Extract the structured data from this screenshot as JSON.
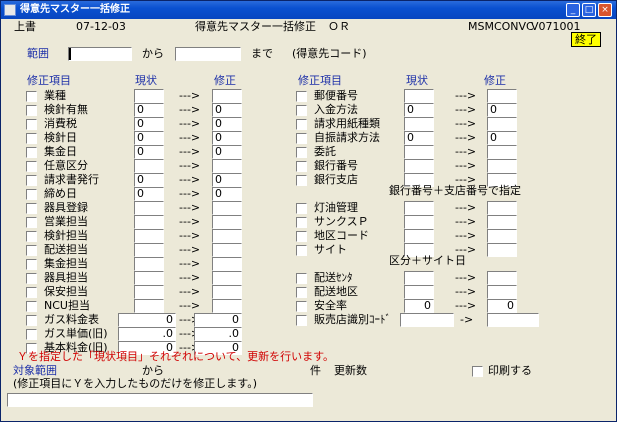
{
  "window": {
    "title": "得意先マスター一括修正"
  },
  "header": {
    "mode": "上書",
    "date": "07-12-03",
    "screen_title": "得意先マスター一括修正",
    "or_label": "ＯＲ",
    "program_id": "MSMCONVC",
    "version": "V071001",
    "exit_label": "終了"
  },
  "range": {
    "label": "範囲",
    "from_label": "から",
    "to_label": "まで",
    "note": "(得意先コード)"
  },
  "columns": {
    "item": "修正項目",
    "current": "現状",
    "modify": "修正"
  },
  "arrow": "--->",
  "arrow_short": "->",
  "left_items": [
    {
      "label": "業種",
      "current": "",
      "modify": ""
    },
    {
      "label": "検針有無",
      "current": "0",
      "modify": "0"
    },
    {
      "label": "消費税",
      "current": "0",
      "modify": "0"
    },
    {
      "label": "検針日",
      "current": "0",
      "modify": "0"
    },
    {
      "label": "集金日",
      "current": "0",
      "modify": "0"
    },
    {
      "label": "任意区分",
      "current": "",
      "modify": ""
    },
    {
      "label": "請求書発行",
      "current": "0",
      "modify": "0"
    },
    {
      "label": "締め日",
      "current": "0",
      "modify": "0"
    },
    {
      "label": "器具登録",
      "current": "",
      "modify": ""
    },
    {
      "label": "営業担当",
      "current": "",
      "modify": ""
    },
    {
      "label": "検針担当",
      "current": "",
      "modify": ""
    },
    {
      "label": "配送担当",
      "current": "",
      "modify": ""
    },
    {
      "label": "集金担当",
      "current": "",
      "modify": ""
    },
    {
      "label": "器具担当",
      "current": "",
      "modify": ""
    },
    {
      "label": "保安担当",
      "current": "",
      "modify": ""
    },
    {
      "label": "NCU担当",
      "current": "",
      "modify": ""
    },
    {
      "label": "ガス料金表",
      "current": "0",
      "modify": "0"
    },
    {
      "label": "ガス単価(旧)",
      "current": ".0",
      "modify": ".0"
    },
    {
      "label": "基本料金(旧)",
      "current": "0",
      "modify": "0"
    }
  ],
  "right_items": [
    {
      "label": "郵便番号",
      "current": "",
      "modify": ""
    },
    {
      "label": "入金方法",
      "current": "0",
      "modify": "0"
    },
    {
      "label": "請求用紙種類",
      "current": "",
      "modify": ""
    },
    {
      "label": "自振請求方法",
      "current": "0",
      "modify": "0"
    },
    {
      "label": "委託",
      "current": "",
      "modify": ""
    },
    {
      "label": "銀行番号",
      "current": "",
      "modify": ""
    },
    {
      "label": "銀行支店",
      "current": "",
      "modify": ""
    },
    {
      "label": "灯油管理",
      "current": "",
      "modify": ""
    },
    {
      "label": "サンクスＰ",
      "current": "",
      "modify": ""
    },
    {
      "label": "地区コード",
      "current": "",
      "modify": ""
    },
    {
      "label": "サイト",
      "current": "",
      "modify": ""
    },
    {
      "label": "配送ｾﾝﾀ",
      "current": "",
      "modify": ""
    },
    {
      "label": "配送地区",
      "current": "",
      "modify": ""
    },
    {
      "label": "安全率",
      "current": "0",
      "modify": "0"
    },
    {
      "label": "販売店識別ｺｰﾄﾞ",
      "current": "",
      "modify": ""
    }
  ],
  "notes": {
    "bank_note": "銀行番号＋支店番号で指定",
    "site_note": "区分＋サイト日"
  },
  "footer": {
    "red_message": "Ｙを指定した「現状項目」それぞれについて、更新を行います。",
    "target_range_label": "対象範囲",
    "from_label": "から",
    "count_label": "件",
    "update_label": "更新数",
    "print_label": "印刷する",
    "instruction": "(修正項目にＹを入力したものだけを修正します。)"
  }
}
